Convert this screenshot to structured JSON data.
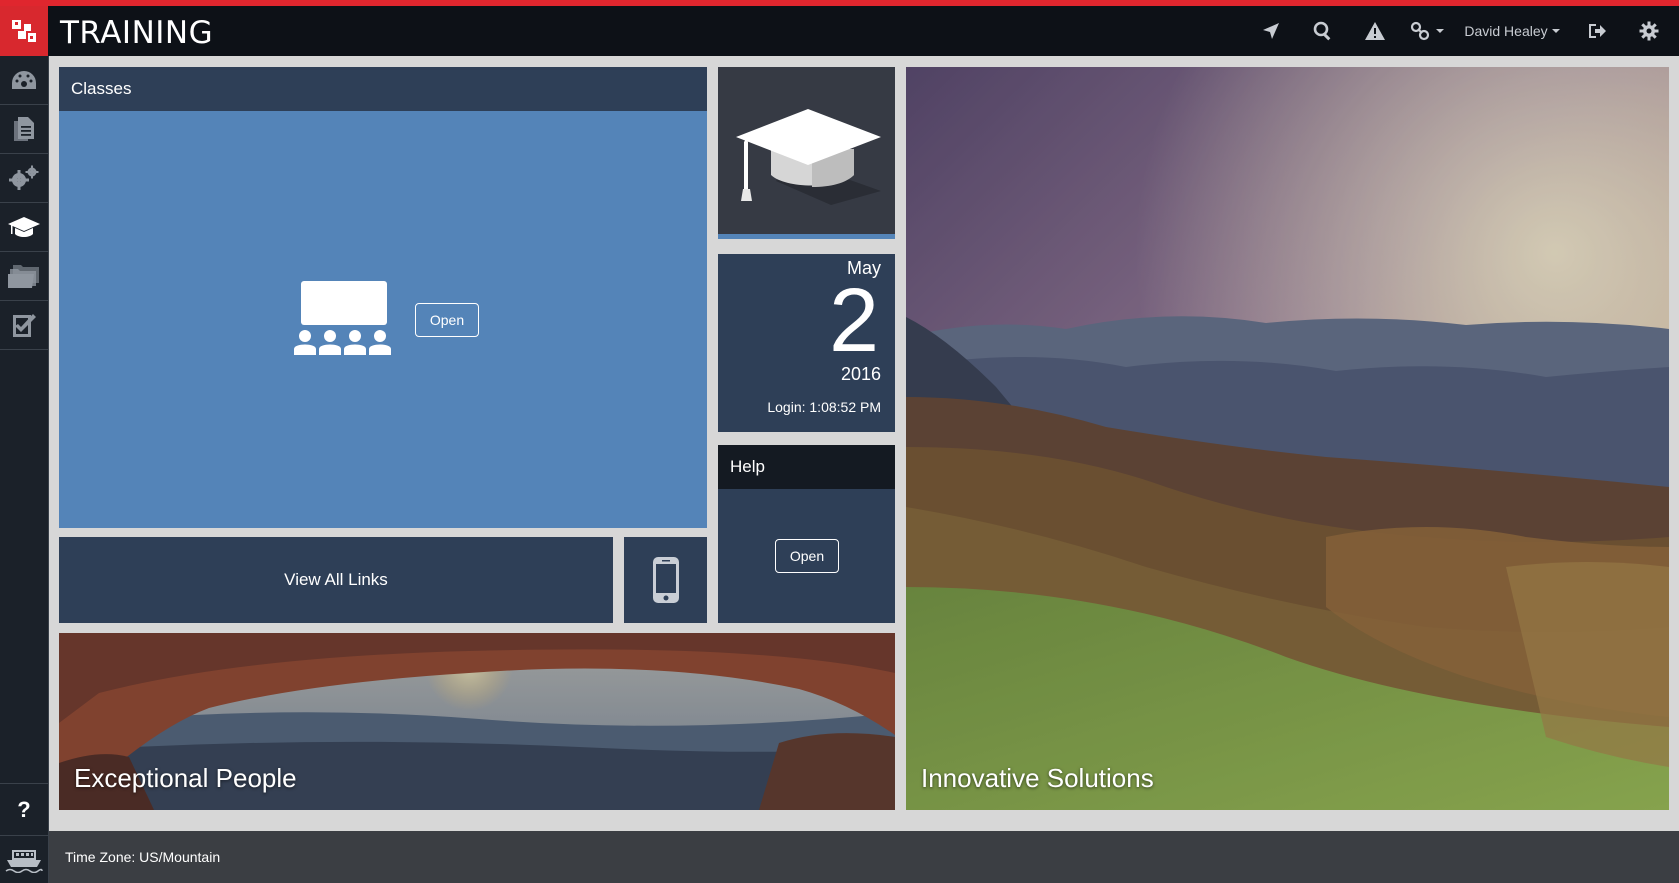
{
  "header": {
    "app_title": "TRAINING",
    "user_name": "David Healey",
    "accent_color": "#e0262e",
    "icons": [
      "location-arrow-icon",
      "search-icon",
      "alert-icon",
      "links-icon",
      "logout-icon",
      "gear-icon"
    ]
  },
  "sidebar": {
    "items": [
      {
        "icon": "dashboard-icon"
      },
      {
        "icon": "document-icon"
      },
      {
        "icon": "gears-icon"
      },
      {
        "icon": "graduation-cap-icon",
        "active": true
      },
      {
        "icon": "folders-icon"
      },
      {
        "icon": "checklist-icon"
      }
    ],
    "help_label": "?",
    "bottom_icon": "boat-icon"
  },
  "tiles": {
    "classes": {
      "title": "Classes",
      "open_label": "Open",
      "icon": "classroom-icon",
      "color": "#5484b8"
    },
    "graduation": {
      "icon": "graduation-cap-icon"
    },
    "date": {
      "month": "May",
      "day": "2",
      "year": "2016",
      "login": "Login: 1:08:52 PM"
    },
    "help": {
      "title": "Help",
      "open_label": "Open"
    },
    "links": {
      "label": "View All Links"
    },
    "phone": {
      "icon": "mobile-phone-icon"
    },
    "people": {
      "caption": "Exceptional People"
    },
    "solutions": {
      "caption": "Innovative Solutions"
    }
  },
  "footer": {
    "timezone": "Time Zone: US/Mountain"
  }
}
